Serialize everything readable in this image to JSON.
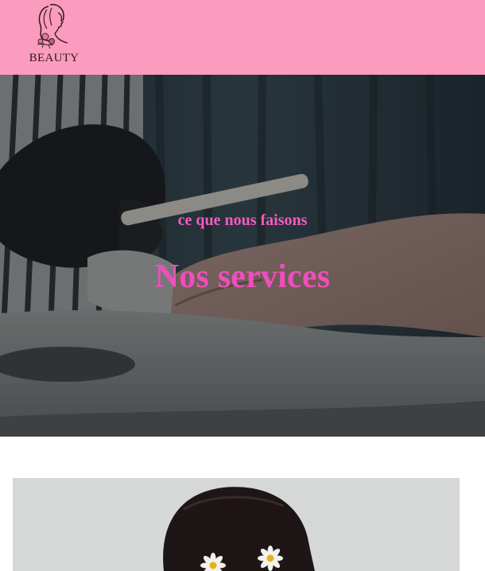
{
  "header": {
    "logo_text": "BEAUTY",
    "background": "#fb9cbe"
  },
  "hero": {
    "subtitle": "ce que nous faisons",
    "title": "Nos services",
    "accent": "#ee4fbb"
  },
  "icons": {
    "logo": "woman-profile-with-flowers-logo-icon"
  }
}
